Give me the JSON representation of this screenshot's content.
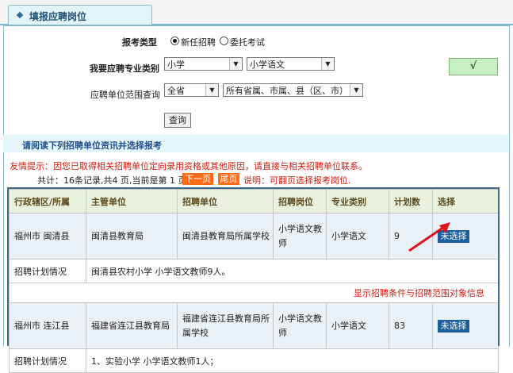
{
  "tab": {
    "title": "填报应聘岗位"
  },
  "form": {
    "exam_type_label": "报考类型",
    "exam_type_options": [
      "新任招聘",
      "委托考试"
    ],
    "major_label": "我要应聘专业类别",
    "major_level": "小学",
    "major_subject": "小学语文",
    "check_mark": "√",
    "range_label": "应聘单位范围查询",
    "range_province": "全省",
    "range_area": "所有省属、市属、县（区、市）",
    "query_button": "查询"
  },
  "notice": {
    "read_hint": "请阅读下列招聘单位资讯并选择报考",
    "tip": "友情提示：因您已取得相关招聘单位定向录用资格或其他原因，请直接与相关招聘单位联系。",
    "pager_text": "共计：16条记录,共4 页,当前是第 1 页",
    "next_page": "下一页",
    "last_page": "尾页",
    "pager_note": "说明：可翻页选择报考岗位."
  },
  "table": {
    "headers": [
      "行政辖区/所属",
      "主管单位",
      "招聘单位",
      "招聘岗位",
      "专业类别",
      "计划数",
      "选择"
    ],
    "rows": [
      {
        "region": "福州市 闽清县",
        "authority": "闽清县教育局",
        "unit": "闽清县教育局所属学校",
        "position": "小学语文教师",
        "major": "小学语文",
        "count": "9",
        "select": "未选择",
        "plan_label": "招聘计划情况",
        "plan": "闽清县农村小学 小学语文教师9人。"
      },
      {
        "region": "福州市 连江县",
        "authority": "福建省连江县教育局",
        "unit": "福建省连江县教育局所属学校",
        "position": "小学语文教师",
        "major": "小学语文",
        "count": "83",
        "select": "未选择",
        "plan_label": "招聘计划情况",
        "plan": "1、实验小学 小学语文教师1人；"
      }
    ],
    "note": "显示招聘条件与招聘范围对象信息"
  },
  "colors": {
    "accent_red": "#d41a0b",
    "select_blue": "#1c5f9c",
    "pager_orange": "#ff6b17"
  }
}
